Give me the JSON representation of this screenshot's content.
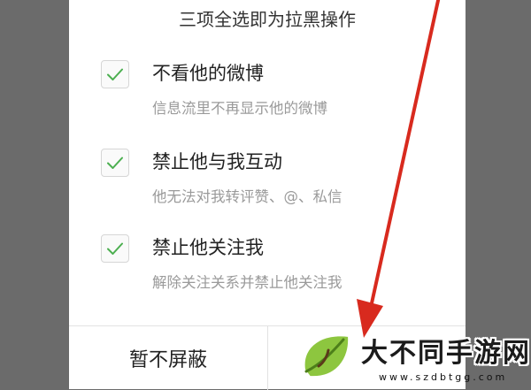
{
  "dialog": {
    "title": "三项全选即为拉黑操作",
    "options": [
      {
        "title": "不看他的微博",
        "description": "信息流里不再显示他的微博",
        "checked": true
      },
      {
        "title": "禁止他与我互动",
        "description": "他无法对我转评赞、@、私信",
        "checked": true
      },
      {
        "title": "禁止他关注我",
        "description": "解除关注关系并禁止他关注我",
        "checked": true
      }
    ],
    "buttons": {
      "cancel_label": "暂不屏蔽",
      "confirm_label": ""
    }
  },
  "watermark": {
    "name": "大不同手游网",
    "url": "www.szdbtgg.com"
  },
  "colors": {
    "backdrop": "#6b6b6b",
    "check": "#4caf50",
    "annotation_arrow": "#d82a1e"
  }
}
